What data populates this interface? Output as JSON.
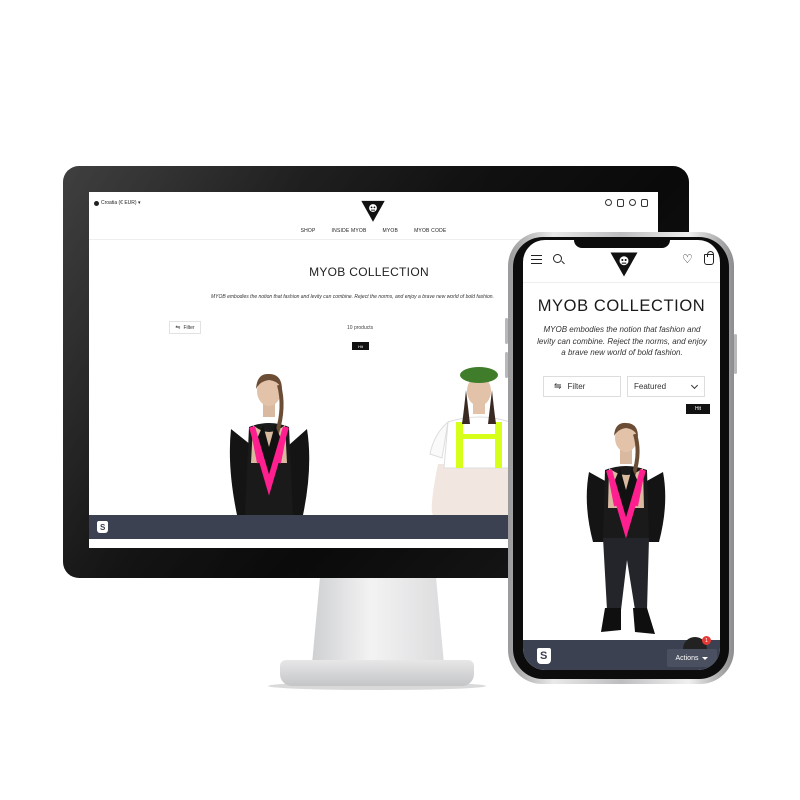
{
  "desktop": {
    "currency": "Croatia (€ EUR) ▾",
    "nav": [
      "SHOP",
      "INSIDE MYOB",
      "MYOB",
      "MYOB CODE"
    ],
    "title": "MYOB COLLECTION",
    "description": "MYOB embodies the notion that fashion and levity can combine. Reject the norms, and enjoy a brave new world of bold fashion.",
    "filter_label": "Filter",
    "product_count": "10 products",
    "badge": "Hit"
  },
  "mobile": {
    "title": "MYOB COLLECTION",
    "description": "MYOB embodies the notion that fashion and levity can combine. Reject the norms, and enjoy a brave new world of bold fashion.",
    "filter_label": "Filter",
    "sort_value": "Featured",
    "badge": "Hit",
    "actions_label": "Actions",
    "notification_count": "1"
  },
  "colors": {
    "bottom_bar": "#3b4150",
    "accent_pink": "#ff1f8e",
    "accent_neon": "#d6ff1a",
    "beret_green": "#3f7d2a"
  },
  "icons": [
    "menu-icon",
    "search-icon",
    "wishlist-icon",
    "bag-icon",
    "account-icon",
    "filter-icon",
    "chevron-down-icon",
    "shopify-icon",
    "myob-logo"
  ]
}
